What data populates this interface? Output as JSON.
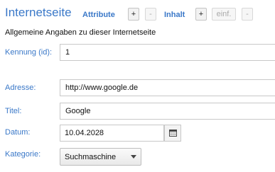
{
  "header": {
    "title": "Internetseite",
    "attribute_link": "Attribute",
    "attr_add": "+",
    "attr_remove": "-",
    "inhalt_link": "Inhalt",
    "inhalt_add": "+",
    "inhalt_insert": "einf.",
    "inhalt_remove": "-"
  },
  "subtitle": "Allgemeine Angaben zu dieser Internetseite",
  "fields": {
    "id": {
      "label": "Kennung (id):",
      "value": "1"
    },
    "adresse": {
      "label": "Adresse:",
      "value": "http://www.google.de"
    },
    "titel": {
      "label": "Titel:",
      "value": "Google"
    },
    "datum": {
      "label": "Datum:",
      "value": "10.04.2028",
      "icon": "calendar-icon"
    },
    "kategorie": {
      "label": "Kategorie:",
      "value": "Suchmaschine"
    }
  },
  "colors": {
    "accent": "#3a78c8",
    "border": "#c8c8c8"
  }
}
